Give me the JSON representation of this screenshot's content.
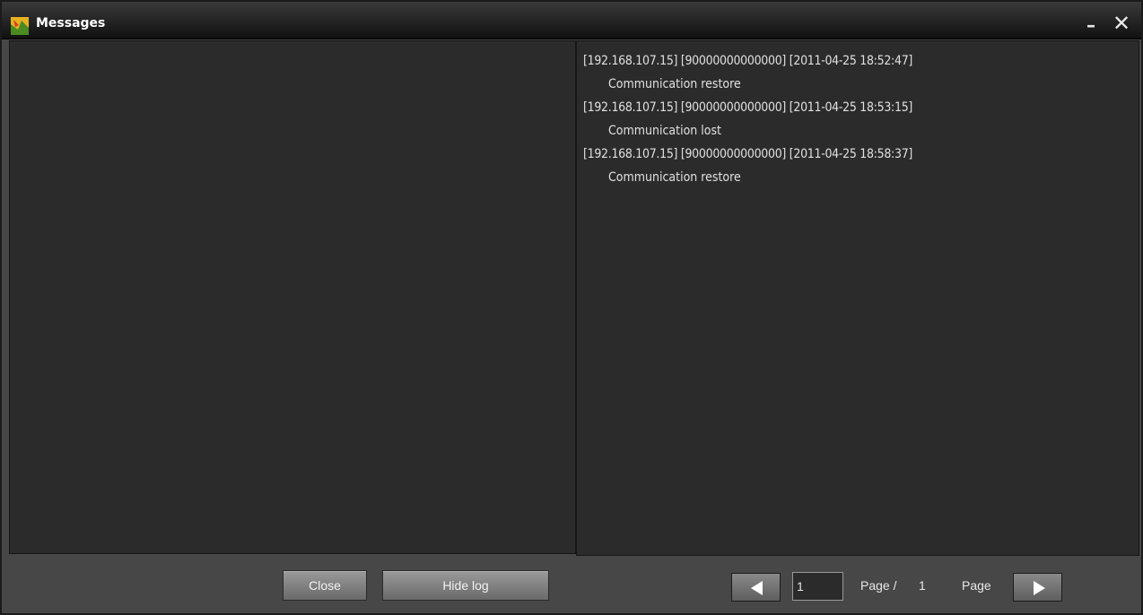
{
  "window": {
    "title": "Messages",
    "minimize_label": "–",
    "close_label": "✕",
    "icon": "app-logo-icon"
  },
  "log": {
    "entries": [
      {
        "header": "[192.168.107.15] [90000000000000] [2011-04-25 18:52:47]",
        "message": "Communication restore"
      },
      {
        "header": "[192.168.107.15] [90000000000000] [2011-04-25 18:53:15]",
        "message": "Communication lost"
      },
      {
        "header": "[192.168.107.15] [90000000000000] [2011-04-25 18:58:37]",
        "message": "Communication restore"
      }
    ]
  },
  "buttons": {
    "close_label": "Close",
    "hide_log_label": "Hide log"
  },
  "pager": {
    "current_page": "1",
    "page_of_label": "Page /",
    "total_pages": "1",
    "page_label": "Page",
    "prev_icon": "arrow-left-icon",
    "next_icon": "arrow-right-icon"
  }
}
